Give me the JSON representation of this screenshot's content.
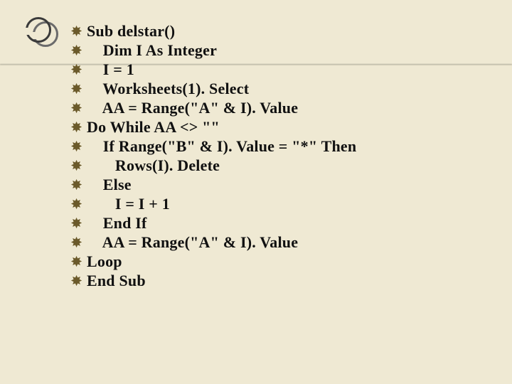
{
  "bullet_glyph": "✸",
  "lines": [
    "Sub delstar()",
    "    Dim I As Integer",
    "    I = 1",
    "    Worksheets(1). Select",
    "    AA = Range(\"A\" & I). Value",
    "Do While AA <> \"\"",
    "    If Range(\"B\" & I). Value = \"*\" Then",
    "       Rows(I). Delete",
    "    Else",
    "       I = I + 1",
    "    End If",
    "    AA = Range(\"A\" & I). Value",
    "Loop",
    "End Sub"
  ]
}
